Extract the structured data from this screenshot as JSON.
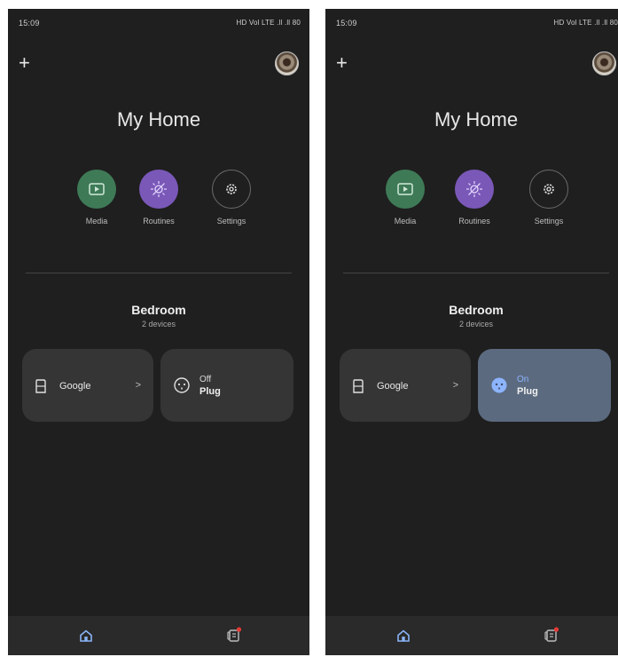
{
  "screens": [
    {
      "status": {
        "time": "15:09",
        "right_indicators": "HD Vol LTE .ll .ll 80"
      },
      "title": "My Home",
      "shortcuts": {
        "media": "Media",
        "routines": "Routines",
        "settings": "Settings"
      },
      "room": {
        "name": "Bedroom",
        "count": "2 devices"
      },
      "devices": {
        "google_label": "Google",
        "google_chevron": ">",
        "plug_state": "Off",
        "plug_name": "Plug"
      }
    },
    {
      "status": {
        "time": "15:09",
        "right_indicators": "HD Vol LTE .ll .ll 80"
      },
      "title": "My Home",
      "shortcuts": {
        "media": "Media",
        "routines": "Routines",
        "settings": "Settings"
      },
      "room": {
        "name": "Bedroom",
        "count": "2 devices"
      },
      "devices": {
        "google_label": "Google",
        "google_chevron": ">",
        "plug_state": "On",
        "plug_name": "Plug"
      }
    }
  ],
  "colors": {
    "background": "#1f1f1f",
    "media": "#3f7a57",
    "routines": "#7a58b8",
    "tile": "#353535",
    "plug_on_tile": "#5b6a7f",
    "plug_on_accent": "#8db4ff",
    "notification_dot": "#e53935"
  },
  "icons": [
    "plus-icon",
    "avatar",
    "play-icon",
    "routines-sun-icon",
    "gear-icon",
    "speaker-icon",
    "chevron-right-icon",
    "plug-icon",
    "home-icon",
    "feed-icon"
  ]
}
